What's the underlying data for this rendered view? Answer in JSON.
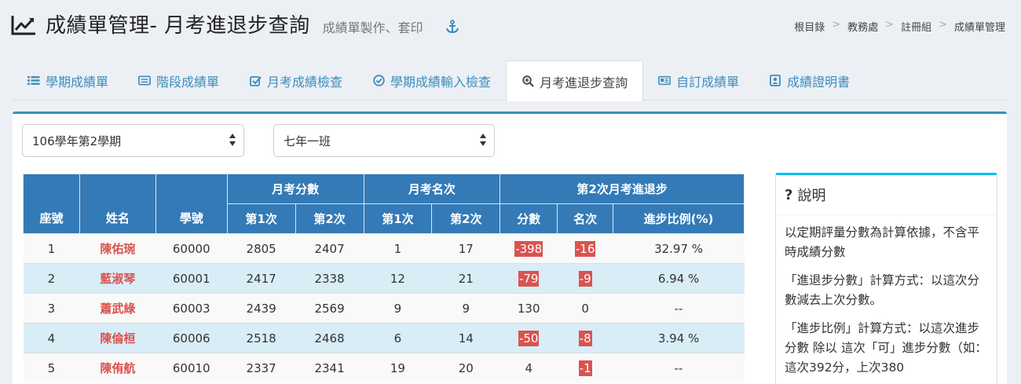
{
  "header": {
    "title": "成績單管理- 月考進退步查詢",
    "subtitle": "成績單製作、套印",
    "anchor_icon": "anchor-icon"
  },
  "breadcrumb": [
    "根目錄",
    "教務處",
    "註冊組",
    "成績單管理"
  ],
  "tabs": [
    {
      "label": "學期成績單",
      "icon": "list-icon",
      "active": false
    },
    {
      "label": "階段成績單",
      "icon": "card-icon",
      "active": false
    },
    {
      "label": "月考成績檢查",
      "icon": "checkbox-icon",
      "active": false
    },
    {
      "label": "學期成績輸入檢查",
      "icon": "check-circle-icon",
      "active": false
    },
    {
      "label": "月考進退步查詢",
      "icon": "zoom-in-icon",
      "active": true
    },
    {
      "label": "自訂成績單",
      "icon": "newspaper-icon",
      "active": false
    },
    {
      "label": "成績證明書",
      "icon": "id-card-icon",
      "active": false
    }
  ],
  "filters": {
    "semester": "106學年第2學期",
    "class": "七年一班"
  },
  "table": {
    "headers": {
      "seat": "座號",
      "name": "姓名",
      "student_id": "學號",
      "score_group": "月考分數",
      "rank_group": "月考名次",
      "progress_group": "第2次月考進退步",
      "first": "第1次",
      "second": "第2次",
      "score": "分數",
      "rank": "名次",
      "ratio": "進步比例(%)"
    },
    "rows": [
      {
        "seat": "1",
        "name": "陳佑琬",
        "id": "60000",
        "s1": "2805",
        "s2": "2407",
        "r1": "1",
        "r2": "17",
        "ds": "-398",
        "dr": "-16",
        "ratio": "32.97 %"
      },
      {
        "seat": "2",
        "name": "藍淑琴",
        "id": "60001",
        "s1": "2417",
        "s2": "2338",
        "r1": "12",
        "r2": "21",
        "ds": "-79",
        "dr": "-9",
        "ratio": "6.94 %"
      },
      {
        "seat": "3",
        "name": "蕭武綠",
        "id": "60003",
        "s1": "2439",
        "s2": "2569",
        "r1": "9",
        "r2": "9",
        "ds": "130",
        "dr": "0",
        "ratio": "--"
      },
      {
        "seat": "4",
        "name": "陳倫桓",
        "id": "60006",
        "s1": "2518",
        "s2": "2468",
        "r1": "6",
        "r2": "14",
        "ds": "-50",
        "dr": "-8",
        "ratio": "3.94 %"
      },
      {
        "seat": "5",
        "name": "陳侑航",
        "id": "60010",
        "s1": "2337",
        "s2": "2341",
        "r1": "19",
        "r2": "20",
        "ds": "4",
        "dr": "-1",
        "ratio": "--"
      }
    ]
  },
  "help": {
    "title": "說明",
    "paragraphs": [
      "以定期評量分數為計算依據，不含平時成績分數",
      "「進退步分數」計算方式：以這次分數減去上次分數。",
      "「進步比例」計算方式：以這次進步分數 除以 這次「可」進步分數（如：這次392分，上次380"
    ]
  },
  "colors": {
    "primary": "#337ab7",
    "link": "#3c8dbc",
    "negative": "#d9534f",
    "row_alt": "#d9edf7",
    "help_accent": "#00c0ef"
  }
}
